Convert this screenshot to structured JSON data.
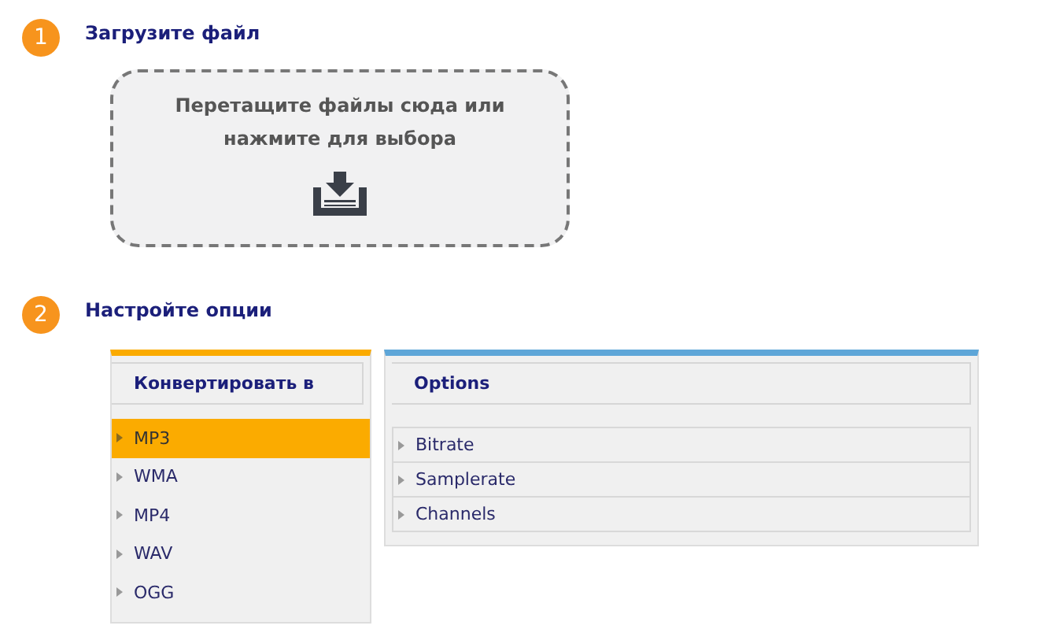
{
  "steps": [
    {
      "number": "1",
      "title": "Загрузите файл"
    },
    {
      "number": "2",
      "title": "Настройте опции"
    }
  ],
  "dropzone": {
    "text_line_1": "Перетащите файлы сюда или",
    "text_line_2": "нажмите для выбора"
  },
  "convert_panel": {
    "title": "Конвертировать в",
    "formats": [
      {
        "label": "MP3",
        "selected": true
      },
      {
        "label": "WMA",
        "selected": false
      },
      {
        "label": "MP4",
        "selected": false
      },
      {
        "label": "WAV",
        "selected": false
      },
      {
        "label": "OGG",
        "selected": false
      }
    ]
  },
  "options_panel": {
    "title": "Options",
    "items": [
      "Bitrate",
      "Samplerate",
      "Channels"
    ]
  }
}
